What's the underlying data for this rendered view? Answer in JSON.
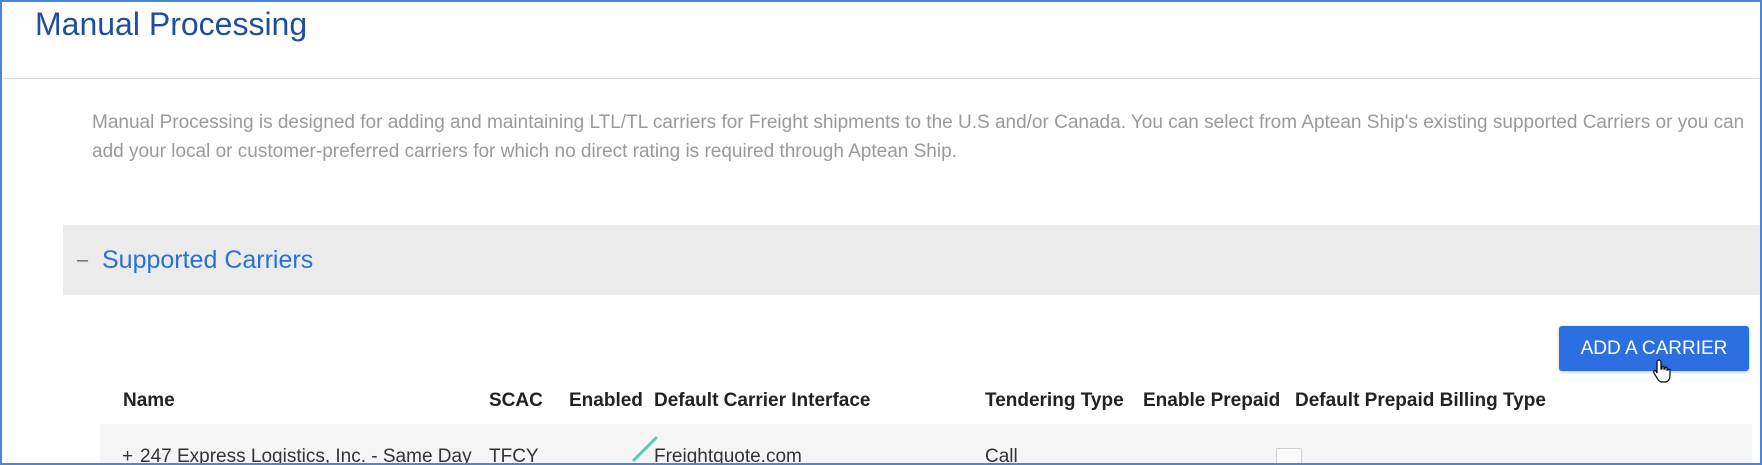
{
  "page": {
    "title": "Manual Processing",
    "description": "Manual Processing is designed for adding and maintaining LTL/TL carriers for Freight shipments to the U.S and/or Canada. You can select from Aptean Ship's existing supported Carriers or you can add your local or customer-preferred carriers for which no direct rating is required through Aptean Ship."
  },
  "section": {
    "toggle_symbol": "–",
    "title": "Supported Carriers"
  },
  "toolbar": {
    "add_label": "ADD A CARRIER"
  },
  "table": {
    "columns": [
      "Name",
      "SCAC",
      "Enabled",
      "Default Carrier Interface",
      "Tendering Type",
      "Enable Prepaid",
      "Default Prepaid Billing Type"
    ],
    "rows": [
      {
        "expand_symbol": "+",
        "name": "247 Express Logistics, Inc. - Same Day",
        "scac": "TFCY",
        "enabled": true,
        "interface": "Freightquote.com",
        "tendering_type": "Call",
        "enable_prepaid": false,
        "prepaid_billing_type": ""
      }
    ]
  },
  "icons": {
    "cursor": "hand-pointer-icon",
    "enabled": "checkmark-icon",
    "edit": "pencil-icon"
  },
  "colors": {
    "title": "#1f4e9c",
    "accent": "#2b6fe0",
    "section_title": "#2872d6",
    "check": "#5cc9b5"
  }
}
